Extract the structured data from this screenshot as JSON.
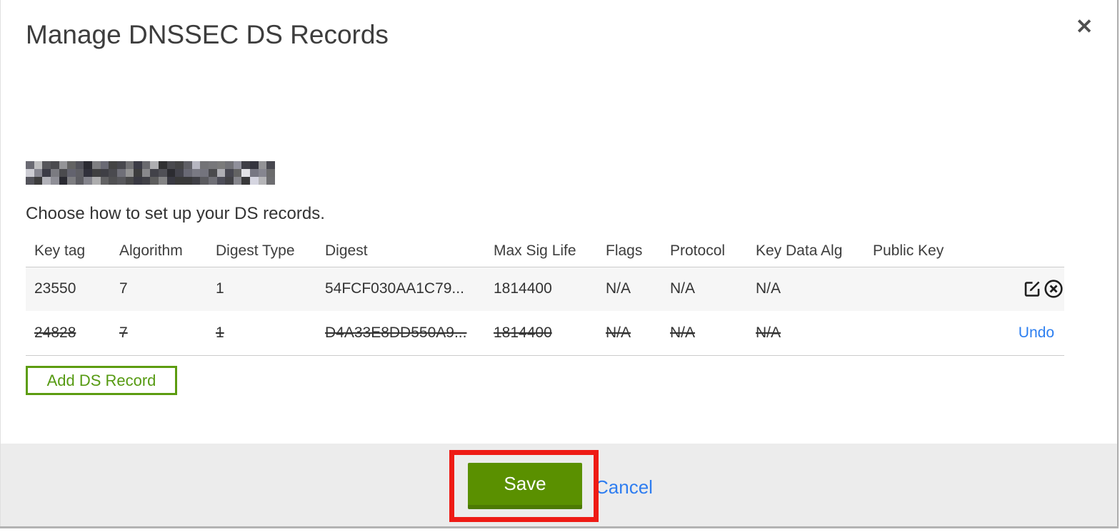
{
  "modal": {
    "title": "Manage DNSSEC DS Records",
    "close_icon": "✕",
    "instruction": "Choose how to set up your DS records."
  },
  "table": {
    "columns": [
      "Key tag",
      "Algorithm",
      "Digest Type",
      "Digest",
      "Max Sig Life",
      "Flags",
      "Protocol",
      "Key Data Alg",
      "Public Key"
    ],
    "rows": [
      {
        "key_tag": "23550",
        "algorithm": "7",
        "digest_type": "1",
        "digest": "54FCF030AA1C79...",
        "max_sig_life": "1814400",
        "flags": "N/A",
        "protocol": "N/A",
        "key_data_alg": "N/A",
        "public_key": "",
        "state": "normal"
      },
      {
        "key_tag": "24828",
        "algorithm": "7",
        "digest_type": "1",
        "digest": "D4A33E8DD550A9...",
        "max_sig_life": "1814400",
        "flags": "N/A",
        "protocol": "N/A",
        "key_data_alg": "N/A",
        "public_key": "",
        "state": "deleted",
        "undo_label": "Undo"
      }
    ]
  },
  "buttons": {
    "add_ds_record": "Add DS Record",
    "save": "Save",
    "cancel": "Cancel"
  },
  "colors": {
    "accent_green": "#5c9c10",
    "save_green": "#5a9000",
    "save_green_dark": "#4c7a02",
    "link_blue": "#2d7ff0",
    "annotation_red": "#ee1b15",
    "row_stripe": "#f6f6f6",
    "footer_bg": "#ececec"
  }
}
